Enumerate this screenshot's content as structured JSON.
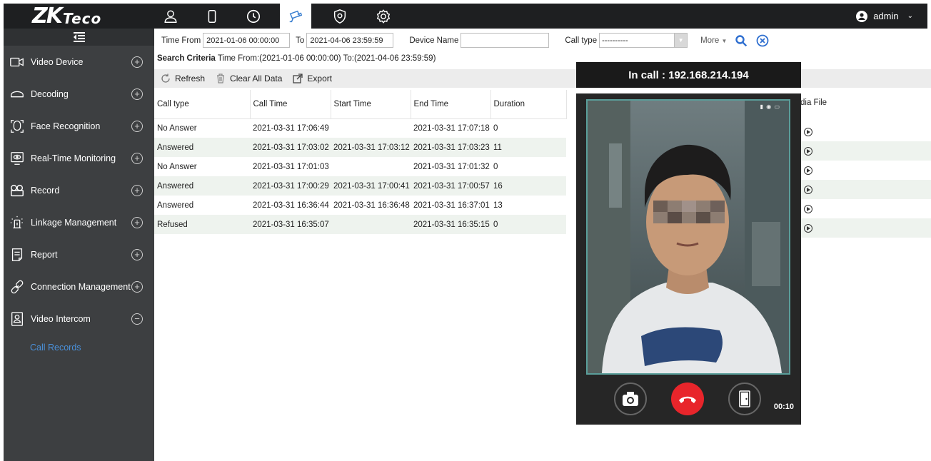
{
  "header": {
    "logo_main": "ZK",
    "logo_sub": "Teco",
    "user": "admin",
    "nav_icons": [
      "person-icon",
      "card-icon",
      "clock-icon",
      "camera-icon",
      "shield-icon",
      "gear-icon"
    ],
    "active_icon": "camera-icon"
  },
  "sidebar": {
    "items": [
      {
        "label": "Video Device",
        "icon": "video-camera-icon",
        "expand": "+"
      },
      {
        "label": "Decoding",
        "icon": "decoder-icon",
        "expand": "+"
      },
      {
        "label": "Face Recognition",
        "icon": "face-icon",
        "expand": "+"
      },
      {
        "label": "Real-Time Monitoring",
        "icon": "monitor-icon",
        "expand": "+"
      },
      {
        "label": "Record",
        "icon": "record-icon",
        "expand": "+"
      },
      {
        "label": "Linkage Management",
        "icon": "linkage-icon",
        "expand": "+"
      },
      {
        "label": "Report",
        "icon": "report-icon",
        "expand": "+"
      },
      {
        "label": "Connection Management",
        "icon": "link-icon",
        "expand": "+"
      },
      {
        "label": "Video Intercom",
        "icon": "intercom-icon",
        "expand": "−"
      }
    ],
    "subitem": "Call Records"
  },
  "filters": {
    "time_from_label": "Time From",
    "time_from_value": "2021-01-06 00:00:00",
    "to_label": "To",
    "to_value": "2021-04-06 23:59:59",
    "device_name_label": "Device Name",
    "device_name_value": "",
    "call_type_label": "Call type",
    "call_type_value": "----------",
    "more_label": "More"
  },
  "criteria": {
    "label": "Search Criteria",
    "text": "Time From:(2021-01-06 00:00:00)  To:(2021-04-06 23:59:59)"
  },
  "toolbar": {
    "refresh": "Refresh",
    "clear": "Clear All Data",
    "export": "Export"
  },
  "table": {
    "columns": [
      "Call type",
      "Call Time",
      "Start Time",
      "End Time",
      "Duration"
    ],
    "media_column": "dia File",
    "rows": [
      {
        "type": "No Answer",
        "call": "2021-03-31 17:06:49",
        "start": "",
        "end": "2021-03-31 17:07:18",
        "duration": "0"
      },
      {
        "type": "Answered",
        "call": "2021-03-31 17:03:02",
        "start": "2021-03-31 17:03:12",
        "end": "2021-03-31 17:03:23",
        "duration": "11"
      },
      {
        "type": "No Answer",
        "call": "2021-03-31 17:01:03",
        "start": "",
        "end": "2021-03-31 17:01:32",
        "duration": "0"
      },
      {
        "type": "Answered",
        "call": "2021-03-31 17:00:29",
        "start": "2021-03-31 17:00:41",
        "end": "2021-03-31 17:00:57",
        "duration": "16"
      },
      {
        "type": "Answered",
        "call": "2021-03-31 16:36:44",
        "start": "2021-03-31 16:36:48",
        "end": "2021-03-31 16:37:01",
        "duration": "13"
      },
      {
        "type": "Refused",
        "call": "2021-03-31 16:35:07",
        "start": "",
        "end": "2021-03-31 16:35:15",
        "duration": "0"
      }
    ]
  },
  "popup": {
    "title": "In call : 192.168.214.194",
    "timer": "00:10",
    "buttons": [
      "camera-icon",
      "hangup-icon",
      "door-icon"
    ]
  }
}
